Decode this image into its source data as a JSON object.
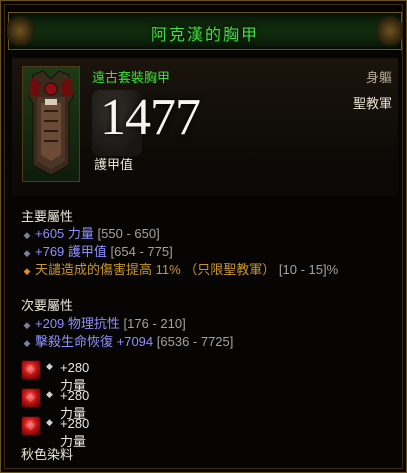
{
  "item": {
    "name": "阿克漢的胸甲",
    "type": "遠古套裝胸甲",
    "slot": "身軀",
    "class": "聖教軍",
    "armor_value": "1477",
    "armor_label": "護甲值"
  },
  "primary": {
    "header": "主要屬性",
    "stats": [
      {
        "value": "+605 力量",
        "range": "[550 - 650]"
      },
      {
        "value": "+769 護甲值",
        "range": "[654 - 775]"
      },
      {
        "value": "天譴造成的傷害提高 11% （只限聖教軍）",
        "range": "[10 - 15]%"
      }
    ]
  },
  "secondary": {
    "header": "次要屬性",
    "stats": [
      {
        "value": "+209 物理抗性",
        "range": "[176 - 210]"
      },
      {
        "value_a": "擊殺生命恢復 ",
        "value_b": "+7094",
        "range": "[6536 - 7725]"
      }
    ]
  },
  "gems": [
    "+280 力量",
    "+280 力量",
    "+280 力量"
  ],
  "dye": "秋色染料",
  "colors": {
    "set_green": "#3fe03a",
    "magic_blue": "#8f8fff",
    "legendary_orange": "#c8962a"
  }
}
